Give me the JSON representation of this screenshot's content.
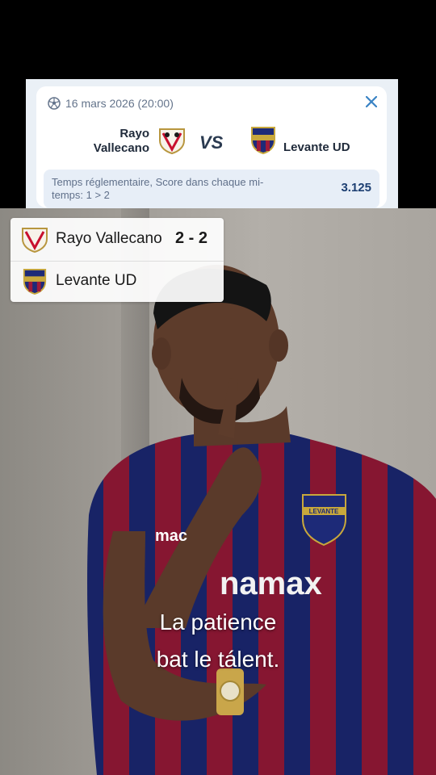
{
  "bet_card": {
    "date": "16 mars 2026 (20:00)",
    "home_team_line1": "Rayo",
    "home_team_line2": "Vallecano",
    "vs_label": "VS",
    "away_team": "Levante UD",
    "market_line1": "Temps réglementaire, Score dans chaque mi-",
    "market_line2": "temps: 1 > 2",
    "odds": "3.125",
    "close_icon": "close-icon",
    "sport_icon": "soccer-ball-icon"
  },
  "score_card": {
    "home": {
      "name": "Rayo Vallecano",
      "score": "2 - 2",
      "crest": "rayo-crest-icon"
    },
    "away": {
      "name": "Levante UD",
      "score": "",
      "crest": "levante-crest-icon"
    }
  },
  "caption": {
    "line1": "La patience",
    "line2": "bat le tálent."
  },
  "jersey": {
    "sponsor": "namax",
    "sponsor_brand": "mac",
    "badge_text": "LEVANTE"
  },
  "colors": {
    "accent_blue": "#3a83c4",
    "odds_blue": "#1d3f72",
    "jersey_blue": "#1d2a78",
    "jersey_red": "#9e1b3a"
  }
}
